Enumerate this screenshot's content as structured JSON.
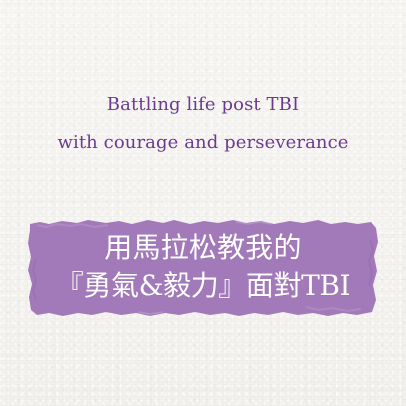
{
  "title_lines": [
    "Battling life post TBI",
    "with courage and perseverance"
  ],
  "chinese_lines": [
    "用馬拉松教我的",
    "『勇氣&毅力』面對TBI"
  ],
  "colors": {
    "background": "#f4f2ee",
    "accent": "#a27ab9",
    "title_text": "#6b3a90",
    "banner_text": "#ffffff"
  }
}
